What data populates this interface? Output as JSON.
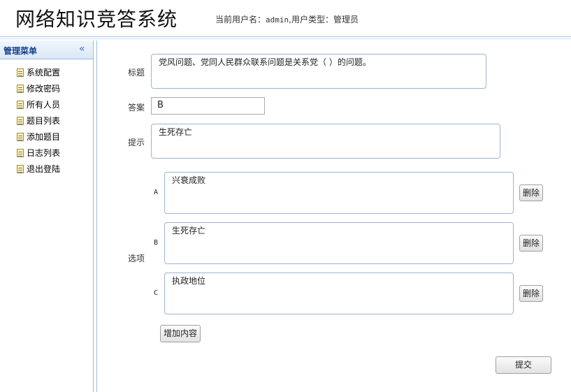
{
  "header": {
    "app_title": "网络知识竞答系统",
    "user_label": "当前用户名：",
    "username": "admin",
    "type_label": ",用户类型：",
    "user_type": "管理员"
  },
  "sidebar": {
    "title": "管理菜单",
    "collapse_icon": "«",
    "items": [
      {
        "label": "系统配置"
      },
      {
        "label": "修改密码"
      },
      {
        "label": "所有人员"
      },
      {
        "label": "题目列表"
      },
      {
        "label": "添加题目"
      },
      {
        "label": "日志列表"
      },
      {
        "label": "退出登陆"
      }
    ]
  },
  "form": {
    "title_label": "标题",
    "title_value": "党风问题、党同人民群众联系问题是关系党（ ）的问题。",
    "answer_label": "答案",
    "answer_value": "B",
    "hint_label": "提示",
    "hint_value": "生死存亡",
    "options_label": "选项",
    "options": [
      {
        "letter": "A",
        "value": "兴衰成败",
        "delete_label": "删除"
      },
      {
        "letter": "B",
        "value": "生死存亡",
        "delete_label": "删除"
      },
      {
        "letter": "C",
        "value": "执政地位",
        "delete_label": "删除"
      }
    ],
    "add_label": "增加内容",
    "submit_label": "提交"
  }
}
